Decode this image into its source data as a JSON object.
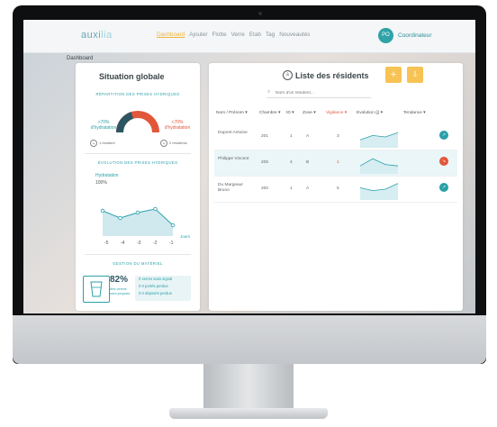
{
  "app": {
    "logo": "auxi",
    "logo_accent": "lia",
    "nav": [
      "Dashboard",
      "Ajouter",
      "Flotte",
      "Verre",
      "Etab",
      "Tag",
      "Nouveautés"
    ],
    "user_initials": "PO",
    "user_role": "Coordinateur"
  },
  "breadcrumb": "Dashboard",
  "situation": {
    "title": "Situation globale",
    "hydration_section": "RÉPARTITION DES PRISES HYDRIQUES",
    "gauge_left_value": ">70%",
    "gauge_left_label": "d'hydratation",
    "gauge_right_value": "<70%",
    "gauge_right_label": "d'hydratation",
    "gauge_left_fraction": 0.4,
    "left_count": "1 résident",
    "right_count": "2 résidents",
    "evolution_section": "ÉVOLUTION DES PRISES HYDRIQUES",
    "hydration_axis_label": "Hydratation",
    "hydration_axis_top": "100%",
    "x_axis_label": "Jours",
    "x_ticks": [
      "-5",
      "-4",
      "-3",
      "-2",
      "-1"
    ],
    "trend_values": [
      0.55,
      0.35,
      0.5,
      0.6,
      0.15
    ],
    "materiel_section": "GESTION DU MATÉRIEL",
    "materiel_pct": "82%",
    "materiel_desc": "des verres sont propres",
    "materiel_list": [
      "0 verres sans signal",
      "0 0 portés perdus",
      "0 0 déposés perdus"
    ]
  },
  "residents": {
    "title": "Liste des résidents",
    "search_placeholder": "Nom d'un résident...",
    "add_label": "+",
    "export_label": "⇩",
    "columns": [
      "Nom / Prénom ▾",
      "Chambre ▾",
      "ID ▾",
      "Zone ▾",
      "Vigilance ▾",
      "Evolution (j) ▾",
      "Tendance ▾"
    ],
    "rows": [
      {
        "name": "Dupont Antoine",
        "chambre": "201",
        "id": "1",
        "zone": "A",
        "vigilance": "3",
        "tendance": "up",
        "trend": [
          0.3,
          0.6,
          0.5,
          0.8
        ]
      },
      {
        "name": "Philippe Vincent",
        "chambre": "205",
        "id": "4",
        "zone": "B",
        "vigilance": "1",
        "tendance": "down",
        "trend": [
          0.3,
          0.8,
          0.4,
          0.3
        ]
      },
      {
        "name": "Du Margeaur Bruno",
        "chambre": "200",
        "id": "1",
        "zone": "A",
        "vigilance": "5",
        "tendance": "up",
        "trend": [
          0.6,
          0.4,
          0.5,
          0.9
        ]
      }
    ]
  },
  "colors": {
    "accent": "#2aa0a8",
    "alert": "#e2563a",
    "button": "#f7c354",
    "highlight": "#eaf6f8"
  }
}
